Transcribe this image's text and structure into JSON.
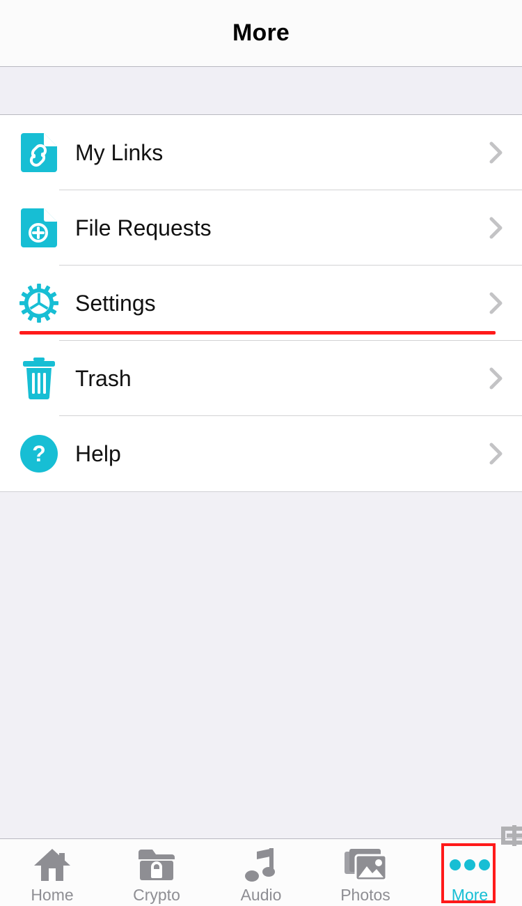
{
  "header": {
    "title": "More"
  },
  "colors": {
    "accent_cyan": "#17bed4",
    "annotation_red": "#ff1a1a",
    "inactive_gray": "#8e8e93",
    "band_gray": "#f0eff5"
  },
  "list": {
    "items": [
      {
        "label": "My Links",
        "icon": "document-link-icon",
        "chevron": "chevron-right-icon"
      },
      {
        "label": "File Requests",
        "icon": "document-plus-icon",
        "chevron": "chevron-right-icon"
      },
      {
        "label": "Settings",
        "icon": "gear-icon",
        "chevron": "chevron-right-icon"
      },
      {
        "label": "Trash",
        "icon": "trash-icon",
        "chevron": "chevron-right-icon"
      },
      {
        "label": "Help",
        "icon": "question-circle-icon",
        "chevron": "chevron-right-icon"
      }
    ]
  },
  "tabbar": {
    "tabs": [
      {
        "label": "Home",
        "icon": "house-icon",
        "active": false
      },
      {
        "label": "Crypto",
        "icon": "folder-lock-icon",
        "active": false
      },
      {
        "label": "Audio",
        "icon": "music-note-icon",
        "active": false
      },
      {
        "label": "Photos",
        "icon": "photos-icon",
        "active": false
      },
      {
        "label": "More",
        "icon": "ellipsis-icon",
        "active": true
      }
    ]
  },
  "overlay": {
    "corner_glyph": "puzzle-piece-icon"
  }
}
